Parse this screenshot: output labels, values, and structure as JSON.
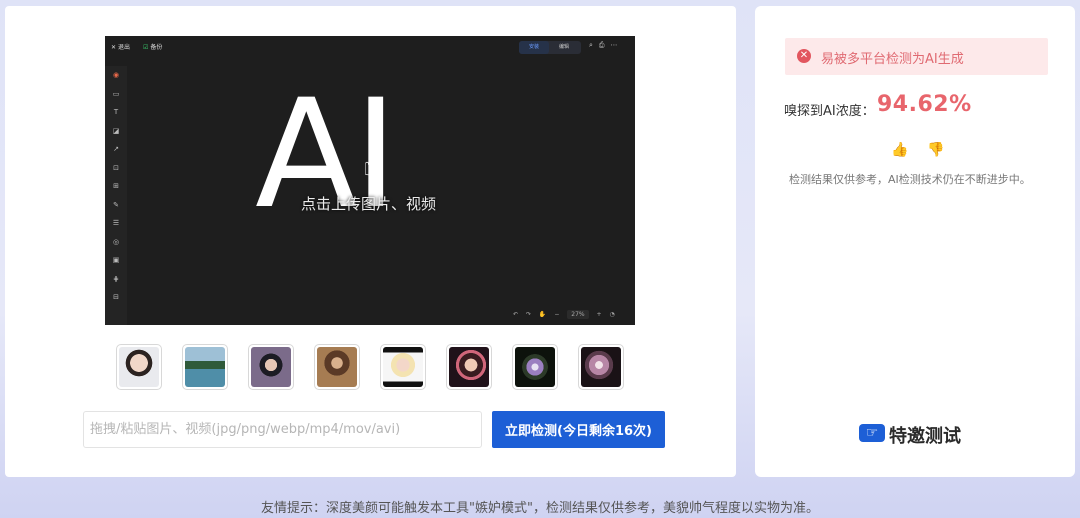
{
  "preview": {
    "exit_label": "退出",
    "save_label": "备份",
    "mode_tabs": [
      "安装",
      "编辑"
    ],
    "sidebar_icons": [
      "logo",
      "rectangle",
      "T",
      "note",
      "pen",
      "frame",
      "table",
      "pencil",
      "list",
      "circle",
      "image",
      "grid",
      "more"
    ],
    "big_text": "AI",
    "upload_hint": "点击上传图片、视频",
    "zoom": "27%"
  },
  "thumbnails": [
    {
      "name": "girl-portrait"
    },
    {
      "name": "lake-boat"
    },
    {
      "name": "asian-man"
    },
    {
      "name": "woman-cafe"
    },
    {
      "name": "blonde-woman"
    },
    {
      "name": "pink-woman"
    },
    {
      "name": "purple-flowers"
    },
    {
      "name": "pink-flowers"
    }
  ],
  "upload": {
    "placeholder": "拖拽/粘贴图片、视频(jpg/png/webp/mp4/mov/avi)",
    "button_label": "立即检测(今日剩余16次)"
  },
  "result": {
    "alert_text": "易被多平台检测为AI生成",
    "score_label": "嗅探到AI浓度：",
    "score_value": "94.62%",
    "disclaimer": "检测结果仅供参考，AI检测技术仍在不断进步中。"
  },
  "invite": {
    "label": "特邀测试"
  },
  "footer": {
    "tip": "友情提示：深度美颜可能触发本工具\"嫉妒模式\"，检测结果仅供参考，美貌帅气程度以实物为准。"
  },
  "colors": {
    "accent_blue": "#1d5fd6",
    "alert_red": "#e8656c",
    "alert_bg": "#fde9ea"
  }
}
